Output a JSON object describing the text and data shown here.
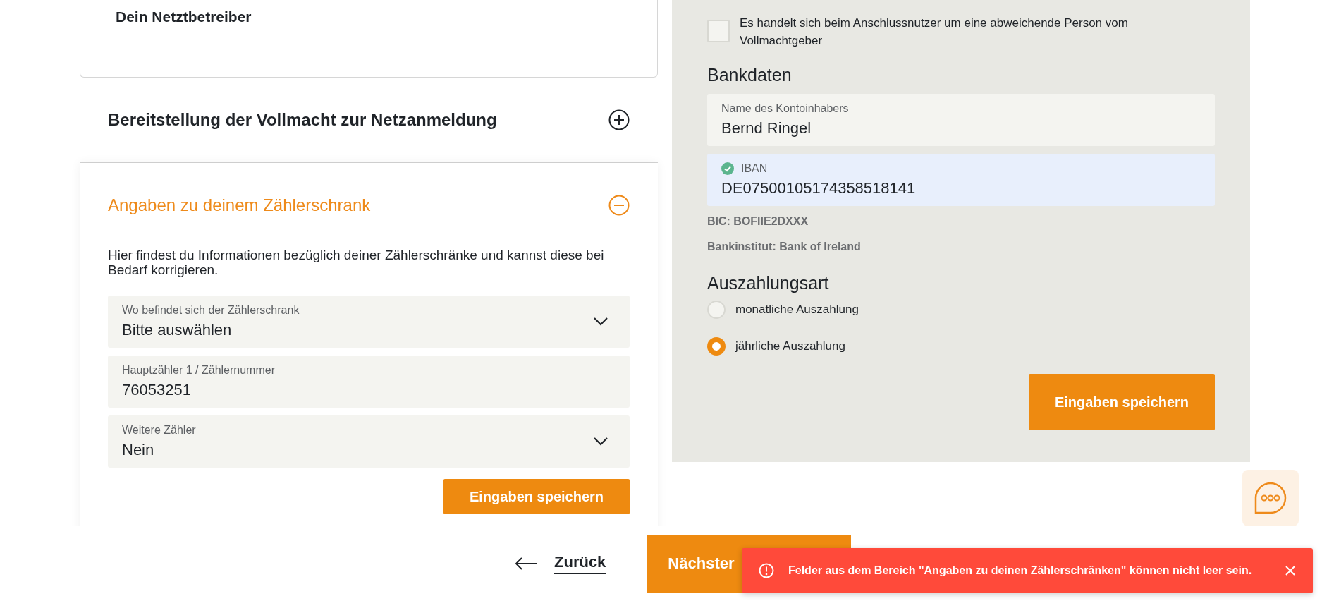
{
  "left": {
    "operator_card": {
      "title": "Dein Netztbetreiber"
    },
    "sections": [
      {
        "title": "Bereitstellung der Vollmacht zur Netzanmeldung",
        "expanded": false
      },
      {
        "title": "Angaben zu deinem Zählerschrank",
        "expanded": true,
        "description": "Hier findest du Informationen bezüglich deiner Zählerschränke und kannst diese bei Bedarf korrigieren.",
        "fields": [
          {
            "kind": "select",
            "label": "Wo befindet sich der Zählerschrank",
            "value": "Bitte auswählen"
          },
          {
            "kind": "text",
            "label": "Hauptzähler 1 / Zählernummer",
            "value": "76053251"
          },
          {
            "kind": "select",
            "label": "Weitere Zähler",
            "value": "Nein"
          }
        ],
        "save_button": "Eingaben speichern"
      }
    ]
  },
  "right": {
    "checkbox": {
      "label": "Es handelt sich beim Anschlussnutzer um eine abweichende Person vom Vollmachtgeber",
      "checked": false
    },
    "bank_heading": "Bankdaten",
    "bank_fields": [
      {
        "label": "Name des Kontoinhabers",
        "value": "Bernd Ringel",
        "valid": false
      },
      {
        "label": "IBAN",
        "value": "DE07500105174358518141",
        "valid": true
      }
    ],
    "bic": "BIC: BOFIIE2DXXX",
    "bank_name": "Bankinstitut: Bank of Ireland",
    "payout_heading": "Auszahlungsart",
    "payout_options": [
      {
        "label": "monatliche Auszahlung",
        "selected": false
      },
      {
        "label": "jährliche Auszahlung",
        "selected": true
      }
    ],
    "save_button": "Eingaben speichern"
  },
  "footer": {
    "back_link": "Zurück",
    "next_button": "Nächster"
  },
  "toast": {
    "message": "Felder aus dem Bereich \"Angaben zu deinen Zählerschränken\" können nicht leer sein."
  }
}
